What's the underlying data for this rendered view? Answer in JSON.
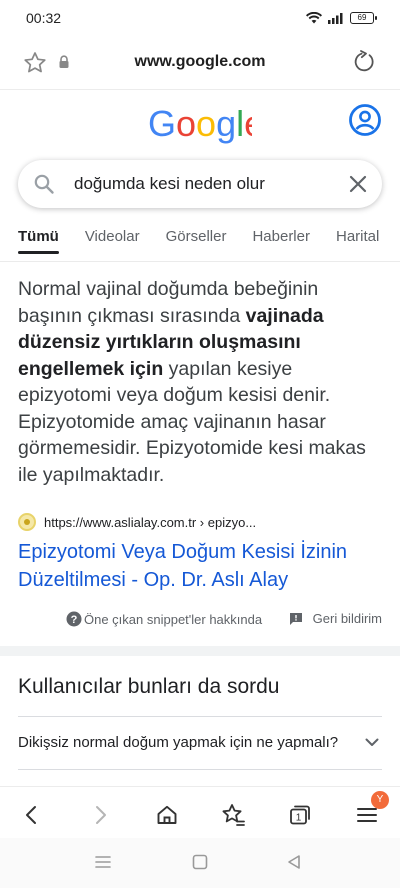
{
  "status": {
    "time": "00:32",
    "battery": "69"
  },
  "browser": {
    "url": "www.google.com",
    "tab_count": "1",
    "menu_badge": "Y"
  },
  "search": {
    "query": "doğumda kesi neden olur"
  },
  "tabs": [
    {
      "label": "Tümü",
      "active": true
    },
    {
      "label": "Videolar"
    },
    {
      "label": "Görseller"
    },
    {
      "label": "Haberler"
    },
    {
      "label": "Harital"
    }
  ],
  "snippet": {
    "text_1": "Normal vajinal doğumda bebeğinin başının çıkması sırasında ",
    "bold": "vajinada düzensiz yırtıkların oluşmasını engellemek için",
    "text_2": " yapılan kesiye epizyotomi veya doğum kesisi denir. Epizyotomide amaç vajinanın hasar görmemesidir. Epizyotomide kesi makas ile yapılmaktadır.",
    "source_url": "https://www.aslialay.com.tr › epizyo...",
    "result_title": "Epizyotomi Veya Doğum Kesisi İzinin Düzeltilmesi - Op. Dr. Aslı Alay",
    "about_label": "Öne çıkan snippet'ler hakkında",
    "feedback_label": "Geri bildirim"
  },
  "paa": {
    "title": "Kullanıcılar bunları da sordu",
    "items": [
      {
        "question": "Dikişsiz normal doğum yapmak için ne yapmalı?"
      }
    ]
  },
  "colors": {
    "link": "#1558d6",
    "google_blue": "#4285F4",
    "google_red": "#EA4335",
    "google_yellow": "#FBBC05",
    "google_green": "#34A853",
    "badge": "#f26b3a"
  }
}
